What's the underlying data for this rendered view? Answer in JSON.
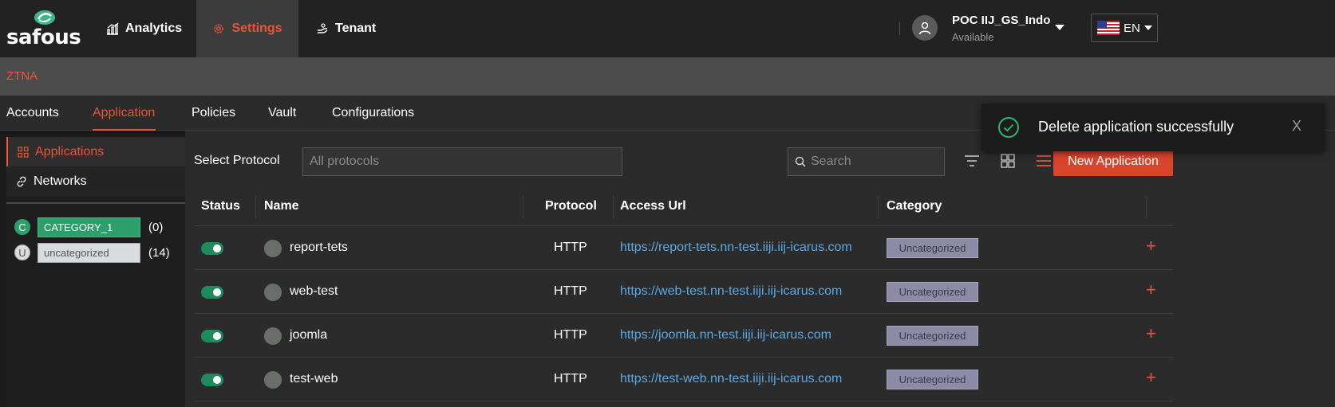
{
  "brand": {
    "name": "safous"
  },
  "topnav": {
    "items": [
      {
        "label": "Analytics",
        "icon": "bar-chart-icon"
      },
      {
        "label": "Settings",
        "icon": "gear-icon",
        "active": true
      },
      {
        "label": "Tenant",
        "icon": "hand-icon"
      }
    ]
  },
  "user": {
    "name": "POC IIJ_GS_Indo",
    "status": "Available"
  },
  "language": {
    "code": "EN",
    "flag": "us-flag-icon"
  },
  "section": {
    "title": "ZTNA"
  },
  "subtabs": [
    {
      "label": "Accounts"
    },
    {
      "label": "Application",
      "active": true
    },
    {
      "label": "Policies"
    },
    {
      "label": "Vault"
    },
    {
      "label": "Configurations"
    }
  ],
  "sidebar": {
    "items": [
      {
        "label": "Applications",
        "icon": "grid-icon",
        "active": true
      },
      {
        "label": "Networks",
        "icon": "link-icon"
      }
    ],
    "categories": [
      {
        "letter": "C",
        "name": "CATEGORY_1",
        "count": "(0)",
        "color": "#2e9e6b"
      },
      {
        "letter": "U",
        "name": "uncategorized",
        "count": "(14)",
        "color": "#d9dcdf"
      }
    ]
  },
  "toolbar": {
    "protocol_label": "Select Protocol",
    "protocol_value": "All protocols",
    "search_placeholder": "Search",
    "new_button": "New Application"
  },
  "table": {
    "columns": [
      "Status",
      "Name",
      "Protocol",
      "Access Url",
      "Category"
    ],
    "rows": [
      {
        "enabled": true,
        "name": "report-tets",
        "protocol": "HTTP",
        "url": "https://report-tets.nn-test.iiji.iij-icarus.com",
        "category": "Uncategorized"
      },
      {
        "enabled": true,
        "name": "web-test",
        "protocol": "HTTP",
        "url": "https://web-test.nn-test.iiji.iij-icarus.com",
        "category": "Uncategorized"
      },
      {
        "enabled": true,
        "name": "joomla",
        "protocol": "HTTP",
        "url": "https://joomla.nn-test.iiji.iij-icarus.com",
        "category": "Uncategorized"
      },
      {
        "enabled": true,
        "name": "test-web",
        "protocol": "HTTP",
        "url": "https://test-web.nn-test.iiji.iij-icarus.com",
        "category": "Uncategorized"
      }
    ]
  },
  "toast": {
    "message": "Delete application successfully",
    "close": "X"
  },
  "colors": {
    "accent": "#e8553a",
    "link": "#5aa9e6",
    "toggle_on": "#1f8a5b"
  }
}
